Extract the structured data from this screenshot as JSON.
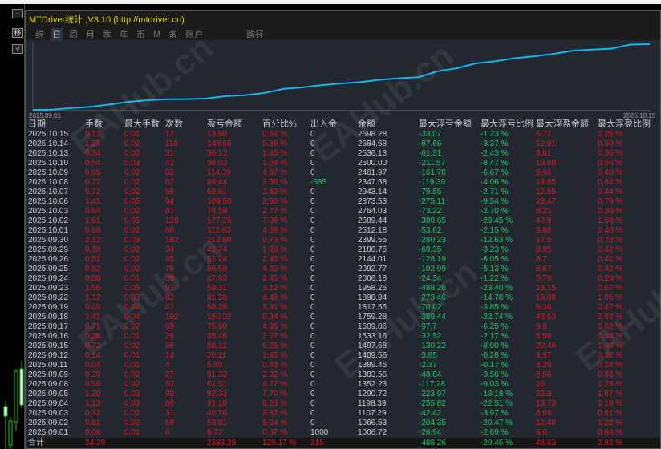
{
  "window": {
    "title": "MTDriver统计 ,V3.10 (http://mtdriver.cn)"
  },
  "leftbar": {
    "btn1": "−",
    "btn2": "移",
    "btn3": "√"
  },
  "tabs": [
    {
      "label": "综"
    },
    {
      "label": "日",
      "active": true
    },
    {
      "label": "周"
    },
    {
      "label": "月"
    },
    {
      "label": "季"
    },
    {
      "label": "年"
    },
    {
      "label": "币"
    },
    {
      "label": "M"
    },
    {
      "label": "备"
    },
    {
      "label": "账户"
    },
    {
      "label": "路径"
    }
  ],
  "chart": {
    "start_label": "2025.09.01",
    "end_label": "2025.10.15",
    "line_color": "#16b4f0"
  },
  "watermark": "EAHub.cn",
  "colors": {
    "profit": "#e0141e",
    "loss": "#19c860",
    "neutral": "#c8ccd4"
  },
  "table": {
    "headers": [
      "日期",
      "手数",
      "最大手数",
      "次数",
      "盈亏金额",
      "百分比%",
      "出入金",
      "余额",
      "最大浮亏金额",
      "最大浮亏比例",
      "最大浮盈金额",
      "最大浮盈比例"
    ],
    "rows": [
      [
        "2025.10.15",
        "0.12",
        "0.01",
        "12",
        "13.60",
        "0.51 %",
        "0",
        "2698.28",
        "-33.07",
        "-1.23 %",
        "6.71",
        "0.25 %"
      ],
      [
        "2025.10.14",
        "1.28",
        "0.02",
        "118",
        "148.55",
        "5.86 %",
        "0",
        "2684.68",
        "-87.66",
        "-3.37 %",
        "12.91",
        "0.50 %"
      ],
      [
        "2025.10.13",
        "0.34",
        "0.02",
        "31",
        "36.13",
        "1.45 %",
        "0",
        "2536.13",
        "-61.31",
        "-2.43 %",
        "9.01",
        "0.36 %"
      ],
      [
        "2025.10.10",
        "0.54",
        "0.03",
        "42",
        "38.03",
        "1.54 %",
        "0",
        "2500.00",
        "-211.57",
        "-8.47 %",
        "13.88",
        "0.56 %"
      ],
      [
        "2025.10.09",
        "0.95",
        "0.02",
        "92",
        "114.39",
        "4.87 %",
        "0",
        "2461.97",
        "-161.78",
        "-6.67 %",
        "9.66",
        "0.40 %"
      ],
      [
        "2025.10.08",
        "0.77",
        "0.02",
        "67",
        "89.44",
        "3.96 %",
        "-685",
        "2347.58",
        "-119.39",
        "-4.06 %",
        "18.85",
        "0.64 %"
      ],
      [
        "2025.10.07",
        "0.72",
        "0.02",
        "66",
        "69.61",
        "2.42 %",
        "0",
        "2943.14",
        "-79.55",
        "-2.71 %",
        "12.85",
        "0.44 %"
      ],
      [
        "2025.10.06",
        "1.41",
        "0.05",
        "94",
        "109.50",
        "3.96 %",
        "0",
        "2873.53",
        "-275.11",
        "-9.54 %",
        "22.47",
        "0.79 %"
      ],
      [
        "2025.10.03",
        "0.64",
        "0.02",
        "61",
        "74.59",
        "2.77 %",
        "0",
        "2764.03",
        "-73.22",
        "-2.70 %",
        "8.21",
        "0.30 %"
      ],
      [
        "2025.10.02",
        "1.61",
        "0.05",
        "120",
        "177.26",
        "7.06 %",
        "0",
        "2689.44",
        "-380.65",
        "-29.45 %",
        "40.9",
        "1.58 %"
      ],
      [
        "2025.10.01",
        "0.88",
        "0.02",
        "86",
        "112.63",
        "4.69 %",
        "0",
        "2512.18",
        "-53.62",
        "-2.15 %",
        "9.88",
        "0.40 %"
      ],
      [
        "2025.09.30",
        "2.12",
        "0.03",
        "182",
        "212.80",
        "9.73 %",
        "0",
        "2399.55",
        "-280.23",
        "-12.63 %",
        "17.5",
        "0.78 %"
      ],
      [
        "2025.09.29",
        "0.38",
        "0.02",
        "34",
        "42.74",
        "1.99 %",
        "0",
        "2186.75",
        "-69.35",
        "-3.23 %",
        "8.95",
        "0.42 %"
      ],
      [
        "2025.09.26",
        "0.51",
        "0.02",
        "45",
        "51.24",
        "2.45 %",
        "0",
        "2144.01",
        "-128.19",
        "-6.05 %",
        "8.7",
        "0.41 %"
      ],
      [
        "2025.09.25",
        "0.82",
        "0.02",
        "75",
        "86.59",
        "4.32 %",
        "0",
        "2092.77",
        "-102.99",
        "-5.13 %",
        "8.67",
        "0.42 %"
      ],
      [
        "2025.09.24",
        "0.38",
        "0.01",
        "38",
        "47.93",
        "2.45 %",
        "0",
        "2006.18",
        "-24.34",
        "-1.22 %",
        "5.78",
        "0.29 %"
      ],
      [
        "2025.09.23",
        "1.56",
        "0.05",
        "97",
        "59.31",
        "3.12 %",
        "0",
        "1958.25",
        "-488.26",
        "-23.40 %",
        "13.15",
        "0.67 %"
      ],
      [
        "2025.09.22",
        "1.12",
        "0.03",
        "82",
        "81.38",
        "4.48 %",
        "0",
        "1898.94",
        "-273.46",
        "-14.78 %",
        "19.08",
        "1.05 %"
      ],
      [
        "2025.09.19",
        "0.49",
        "0.02",
        "47",
        "58.28",
        "3.31 %",
        "0",
        "1817.56",
        "-70.02",
        "-3.85 %",
        "8.36",
        "0.47 %"
      ],
      [
        "2025.09.18",
        "1.41",
        "0.04",
        "102",
        "150.22",
        "9.34 %",
        "0",
        "1759.28",
        "-389.44",
        "-22.74 %",
        "48.63",
        "2.92 %"
      ],
      [
        "2025.09.17",
        "0.71",
        "0.02",
        "69",
        "75.90",
        "4.95 %",
        "0",
        "1609.06",
        "-97.7",
        "-6.25 %",
        "9.8",
        "0.62 %"
      ],
      [
        "2025.09.16",
        "0.28",
        "0.01",
        "28",
        "35.48",
        "2.37 %",
        "0",
        "1533.16",
        "-32.52",
        "-2.17 %",
        "6.59",
        "0.44 %"
      ],
      [
        "2025.09.15",
        "0.72",
        "0.02",
        "66",
        "88.12",
        "6.25 %",
        "0",
        "1497.68",
        "-130.22",
        "-8.90 %",
        "20.46",
        "1.40 %"
      ],
      [
        "2025.09.12",
        "0.14",
        "0.01",
        "14",
        "20.11",
        "1.45 %",
        "0",
        "1409.56",
        "-3.85",
        "-0.28 %",
        "4.37",
        "0.32 %"
      ],
      [
        "2025.09.11",
        "0.04",
        "0.01",
        "4",
        "5.89",
        "0.43 %",
        "0",
        "1389.45",
        "-2.37",
        "-0.17 %",
        "3.29",
        "0.24 %"
      ],
      [
        "2025.09.09",
        "0.29",
        "0.02",
        "27",
        "31.33",
        "2.32 %",
        "0",
        "1383.56",
        "-48.84",
        "-3.56 %",
        "8.66",
        "0.63 %"
      ],
      [
        "2025.09.08",
        "0.56",
        "0.02",
        "52",
        "61.51",
        "4.77 %",
        "0",
        "1352.23",
        "-117.28",
        "-9.03 %",
        "16",
        "1.23 %"
      ],
      [
        "2025.09.05",
        "1.20",
        "0.03",
        "99",
        "92.33",
        "7.70 %",
        "0",
        "1290.72",
        "-223.97",
        "-18.18 %",
        "23.3",
        "1.87 %"
      ],
      [
        "2025.09.04",
        "1.13",
        "0.03",
        "86",
        "91.10",
        "8.23 %",
        "0",
        "1198.39",
        "-255.82",
        "-22.51 %",
        "13.73",
        "1.19 %"
      ],
      [
        "2025.09.03",
        "0.32",
        "0.02",
        "31",
        "40.76",
        "3.82 %",
        "0",
        "1107.29",
        "-42.42",
        "-3.97 %",
        "8.69",
        "0.81 %"
      ],
      [
        "2025.09.02",
        "0.81",
        "0.03",
        "59",
        "59.81",
        "5.94 %",
        "0",
        "1066.53",
        "-204.35",
        "-20.47 %",
        "12.48",
        "1.22 %"
      ],
      [
        "2025.09.01",
        "0.06",
        "0.01",
        "6",
        "6.72",
        "0.67 %",
        "1000",
        "1006.72",
        "-26.94",
        "-2.69 %",
        "6.6",
        "0.66 %"
      ]
    ],
    "total": [
      "合计",
      "24.29",
      "",
      "",
      "2383.28",
      "129.17 %",
      "315",
      "",
      "-488.26",
      "-29.45 %",
      "48.63",
      "2.92 %"
    ]
  }
}
